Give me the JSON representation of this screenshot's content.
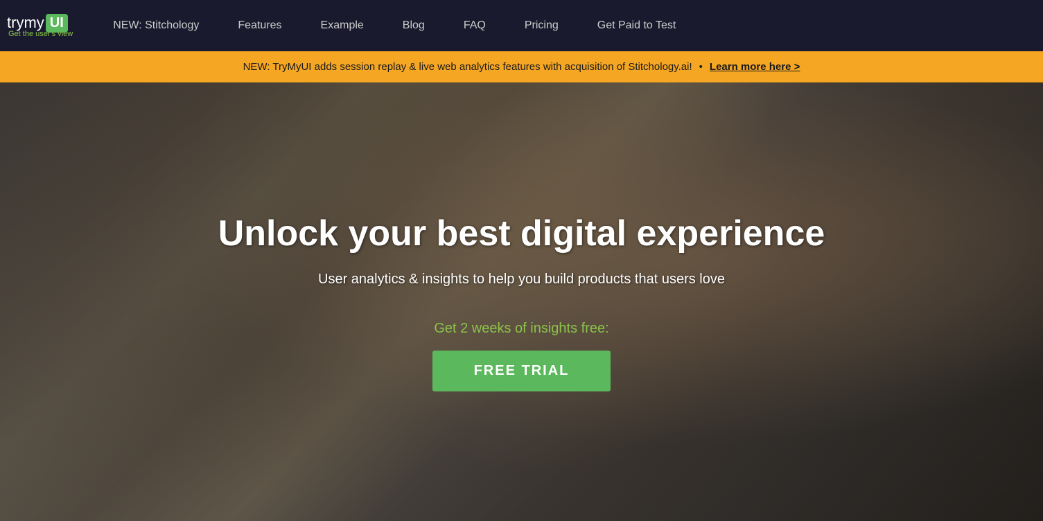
{
  "navbar": {
    "logo": {
      "try": "try",
      "my": "my",
      "ui_box": "UI",
      "tagline": "Get the user's view"
    },
    "links": [
      {
        "label": "NEW: Stitchology",
        "href": "#",
        "active": false
      },
      {
        "label": "Features",
        "href": "#",
        "active": false
      },
      {
        "label": "Example",
        "href": "#",
        "active": false
      },
      {
        "label": "Blog",
        "href": "#",
        "active": false
      },
      {
        "label": "FAQ",
        "href": "#",
        "active": false
      },
      {
        "label": "Pricing",
        "href": "#",
        "active": false
      },
      {
        "label": "Get Paid to Test",
        "href": "#",
        "active": false
      }
    ]
  },
  "announcement": {
    "text": "NEW: TryMyUI adds session replay & live web analytics features with acquisition of Stitchology.ai!",
    "dot": "•",
    "link_label": "Learn more here >"
  },
  "hero": {
    "headline": "Unlock your best digital experience",
    "subheadline": "User analytics & insights to help you build products that users love",
    "cta_label": "Get 2 weeks of insights free:",
    "cta_button": "FREE TRIAL"
  }
}
